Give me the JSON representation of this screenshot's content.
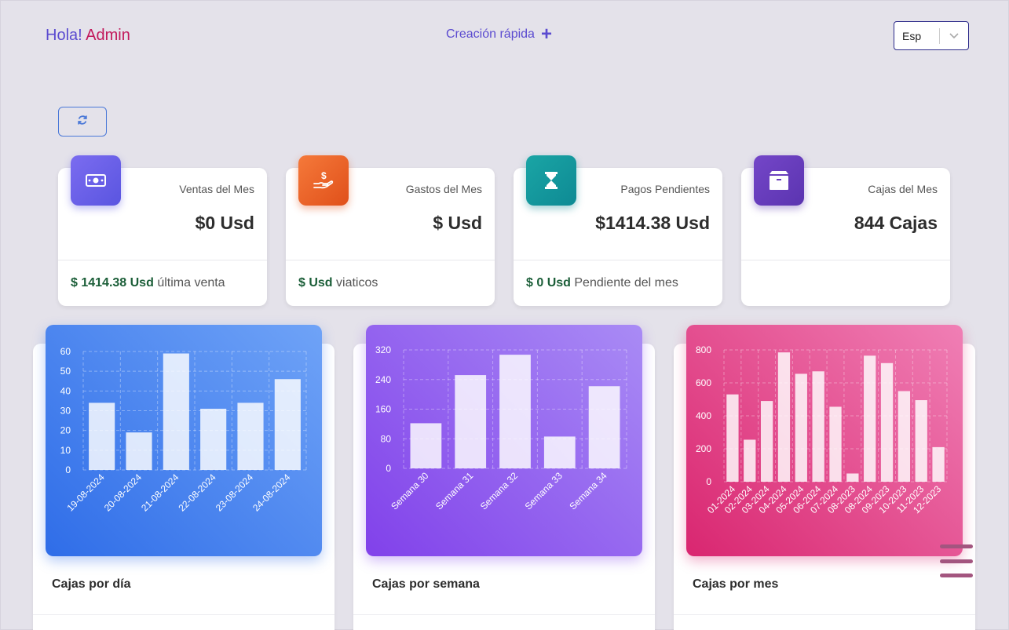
{
  "header": {
    "greeting": "Hola!",
    "user": "Admin",
    "quick_create": "Creación rápida",
    "language": "Esp"
  },
  "stats": [
    {
      "label": "Ventas del Mes",
      "value": "$0 Usd",
      "foot_bold": "$ 1414.38 Usd",
      "foot_text": "última venta",
      "icon": "money-icon",
      "color": "#6a5ff0"
    },
    {
      "label": "Gastos del Mes",
      "value": "$ Usd",
      "foot_bold": "$ Usd",
      "foot_text": "viaticos",
      "icon": "hand-dollar-icon",
      "color": "#e8631f"
    },
    {
      "label": "Pagos Pendientes",
      "value": "$1414.38 Usd",
      "foot_bold": "$ 0 Usd",
      "foot_text": "Pendiente del mes",
      "icon": "hourglass-icon",
      "color": "#14999f"
    },
    {
      "label": "Cajas del Mes",
      "value": "844 Cajas",
      "foot_bold": "",
      "foot_text": "",
      "icon": "box-icon",
      "color": "#6a3dbc"
    }
  ],
  "chart_titles": [
    "Cajas por día",
    "Cajas por semana",
    "Cajas por mes"
  ],
  "chart_data": [
    {
      "type": "bar",
      "categories": [
        "19-08-2024",
        "20-08-2024",
        "21-08-2024",
        "22-08-2024",
        "23-08-2024",
        "24-08-2024"
      ],
      "values": [
        34,
        19,
        59,
        31,
        34,
        46
      ],
      "ylim": [
        0,
        60
      ],
      "yticks": [
        0,
        10,
        20,
        30,
        40,
        50,
        60
      ],
      "grid": true
    },
    {
      "type": "bar",
      "categories": [
        "Semana 30",
        "Semana 31",
        "Semana 32",
        "Semana 33",
        "Semana 34"
      ],
      "values": [
        122,
        252,
        307,
        86,
        222
      ],
      "ylim": [
        0,
        320
      ],
      "yticks": [
        0,
        80,
        160,
        240,
        320
      ],
      "grid": true
    },
    {
      "type": "bar",
      "categories": [
        "01-2024",
        "02-2024",
        "03-2024",
        "04-2024",
        "05-2024",
        "06-2024",
        "07-2024",
        "08-2023",
        "08-2024",
        "09-2023",
        "10-2023",
        "11-2023",
        "12-2023"
      ],
      "values": [
        530,
        255,
        490,
        785,
        655,
        670,
        455,
        50,
        765,
        720,
        550,
        495,
        210
      ],
      "ylim": [
        0,
        800
      ],
      "yticks": [
        0,
        200,
        400,
        600,
        800
      ],
      "grid": true
    }
  ],
  "colors": {
    "primary": "#5b4bd0",
    "accent": "#c2185b",
    "positive": "#1b5e38"
  }
}
